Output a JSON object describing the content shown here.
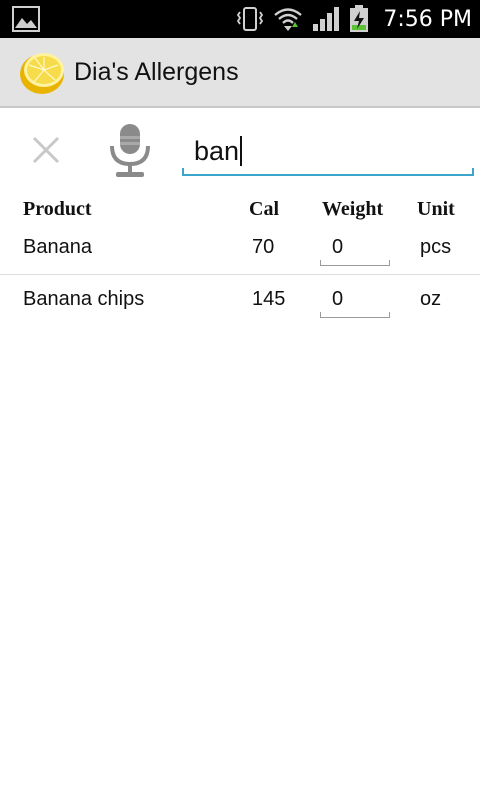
{
  "status_bar": {
    "time": "7:56 PM",
    "icons": [
      "image-notification-icon",
      "vibrate-icon",
      "wifi-icon",
      "signal-icon",
      "battery-charging-icon"
    ]
  },
  "action_bar": {
    "title": "Dia's Allergens",
    "icon": "lemon-icon"
  },
  "search": {
    "value": "ban",
    "clear_icon": "close-icon",
    "mic_icon": "microphone-icon",
    "accent_color": "#3aa6c9"
  },
  "table": {
    "headers": {
      "product": "Product",
      "cal": "Cal",
      "weight": "Weight",
      "unit": "Unit"
    },
    "rows": [
      {
        "product": "Banana",
        "cal": "70",
        "weight": "0",
        "unit": "pcs"
      },
      {
        "product": "Banana chips",
        "cal": "145",
        "weight": "0",
        "unit": "oz"
      }
    ]
  }
}
